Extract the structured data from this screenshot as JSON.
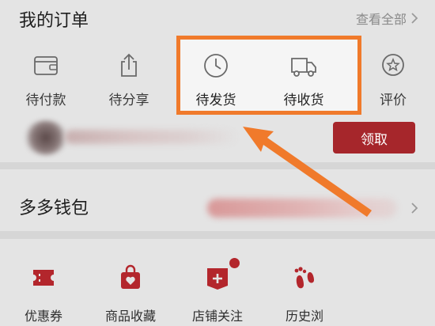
{
  "orders": {
    "title": "我的订单",
    "view_all": "查看全部",
    "items": [
      {
        "label": "待付款",
        "icon": "wallet-icon"
      },
      {
        "label": "待分享",
        "icon": "share-icon"
      },
      {
        "label": "待发货",
        "icon": "clock-icon"
      },
      {
        "label": "待收货",
        "icon": "truck-icon"
      },
      {
        "label": "评价",
        "icon": "star-comment-icon"
      }
    ],
    "claim_button": "领取"
  },
  "wallet": {
    "title": "多多钱包"
  },
  "services": {
    "items": [
      {
        "label": "优惠券",
        "icon": "ticket-icon"
      },
      {
        "label": "商品收藏",
        "icon": "favorite-bag-icon"
      },
      {
        "label": "店铺关注",
        "icon": "store-follow-icon"
      },
      {
        "label": "历史浏",
        "icon": "footprint-icon"
      }
    ]
  },
  "colors": {
    "accent_red": "#a6262b",
    "highlight_orange": "#f07a2b"
  }
}
